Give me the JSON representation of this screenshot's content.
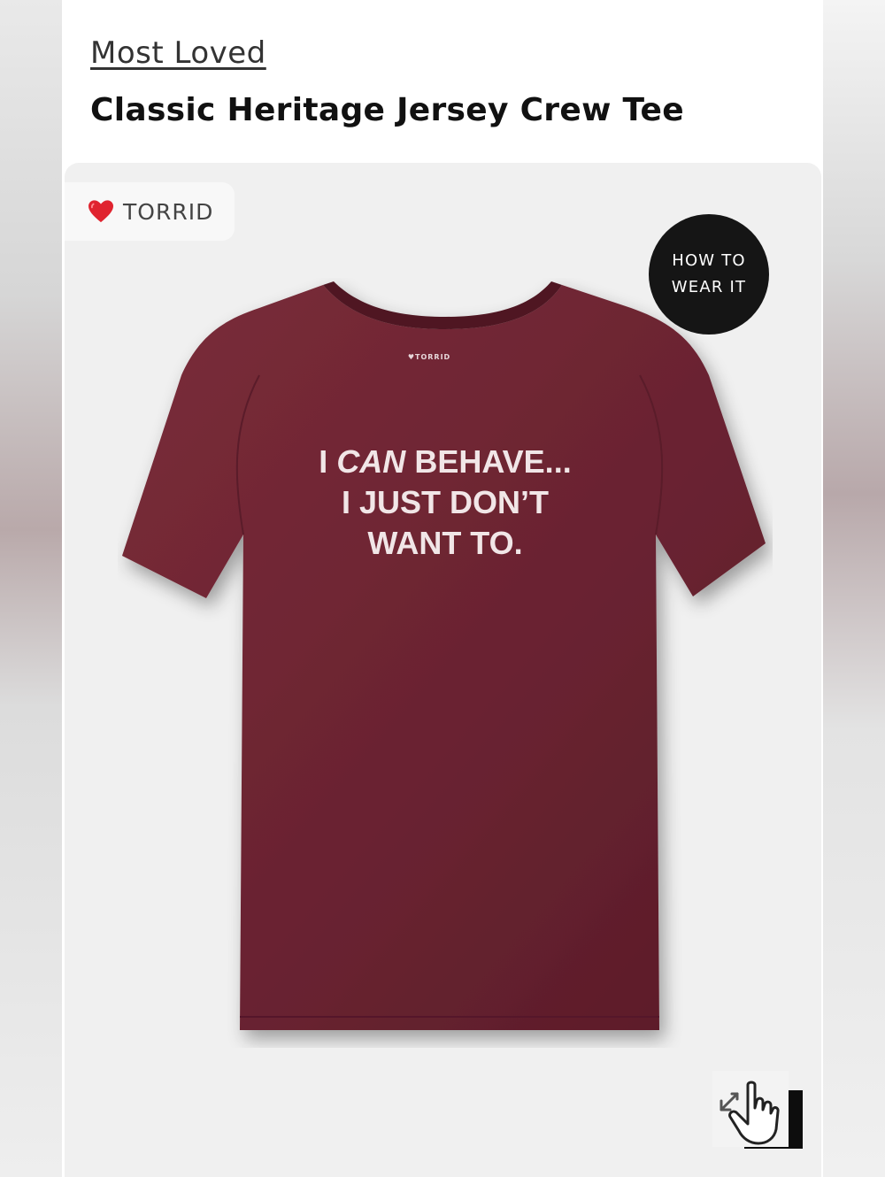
{
  "section": {
    "label": "Most Loved"
  },
  "product": {
    "title": "Classic Heritage Jersey Crew Tee",
    "brand": "TORRID",
    "brand_icon": "heart-icon",
    "shirt_color": "#6e2632",
    "shirt_print": {
      "line1_a": "I",
      "line1_b": "CAN",
      "line1_c": "BEHAVE...",
      "line2": "I JUST DON’T",
      "line3": "WANT TO.",
      "neck_label": "♥TORRID"
    }
  },
  "how_to_wear": {
    "line1": "HOW TO",
    "line2": "WEAR IT"
  },
  "controls": {
    "expand_icon": "expand-icon",
    "pointer_icon": "hand-pointer-icon"
  },
  "colors": {
    "background": "#ffffff",
    "card_background": "#f0f0f0",
    "accent_dark": "#151515",
    "heart": "#e0242f"
  }
}
